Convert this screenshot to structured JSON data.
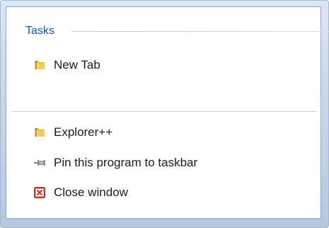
{
  "tasks_header": "Tasks",
  "task_items": [
    {
      "label": "New Tab",
      "icon": "folder-icon"
    }
  ],
  "program_items": [
    {
      "label": "Explorer++",
      "icon": "folder-icon"
    },
    {
      "label": "Pin this program to taskbar",
      "icon": "pin-icon"
    },
    {
      "label": "Close window",
      "icon": "close-window-icon"
    }
  ],
  "colors": {
    "header_text": "#1e4fa6",
    "close_icon_red": "#c9372c",
    "folder_yellow": "#e8b93a"
  }
}
